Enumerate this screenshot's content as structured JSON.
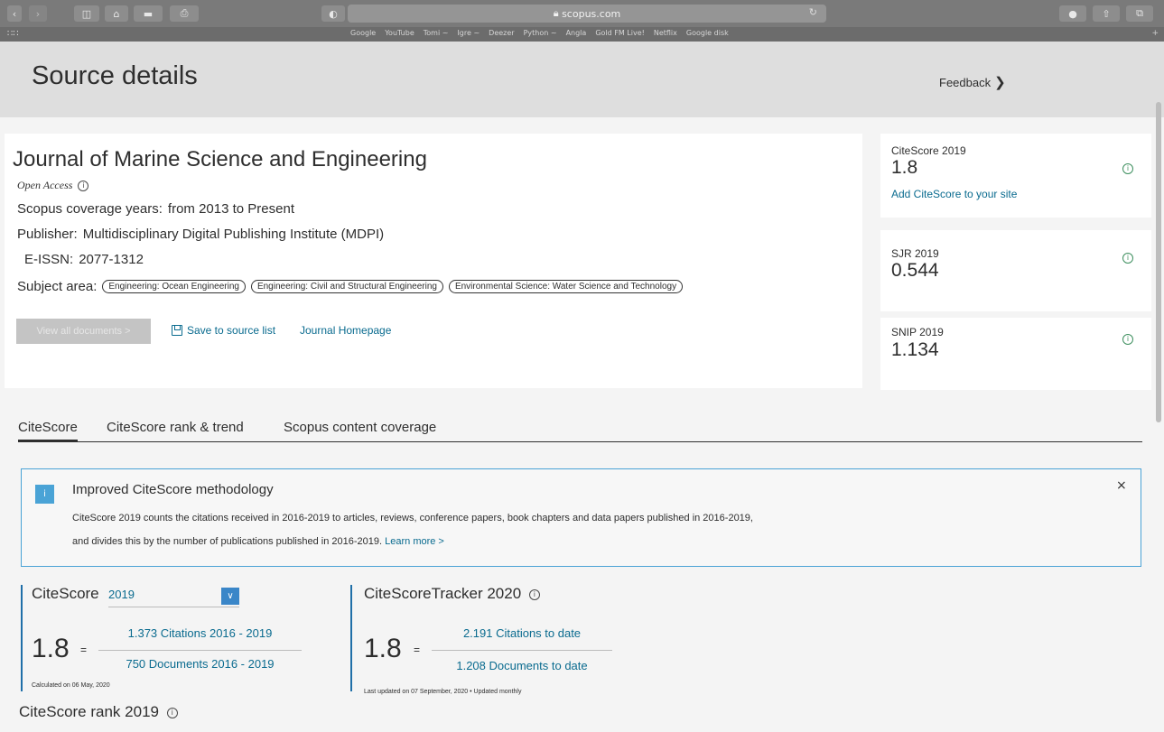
{
  "browser": {
    "url": "scopus.com",
    "bookmarks": [
      "Google",
      "YouTube",
      "Tomi ~",
      "Igre ~",
      "Deezer",
      "Python ~",
      "Angla",
      "Gold FM Live!",
      "Netflix",
      "Google disk"
    ]
  },
  "header": {
    "title": "Source details",
    "feedback_label": "Feedback"
  },
  "journal": {
    "title": "Journal of Marine Science and Engineering",
    "access": "Open Access",
    "coverage_label": "Scopus coverage years:",
    "coverage_value": "from 2013 to Present",
    "publisher_label": "Publisher:",
    "publisher_value": "Multidisciplinary Digital Publishing Institute (MDPI)",
    "eissn_label": "E-ISSN:",
    "eissn_value": "2077-1312",
    "subject_label": "Subject area:",
    "subjects": [
      "Engineering: Ocean Engineering",
      "Engineering: Civil and Structural Engineering",
      "Environmental Science: Water Science and Technology"
    ],
    "view_docs_label": "View all documents >",
    "save_label": "Save to source list",
    "homepage_label": "Journal Homepage"
  },
  "metrics": {
    "citescore": {
      "label": "CiteScore 2019",
      "value": "1.8",
      "link": "Add CiteScore to your site"
    },
    "sjr": {
      "label": "SJR 2019",
      "value": "0.544"
    },
    "snip": {
      "label": "SNIP 2019",
      "value": "1.134"
    }
  },
  "tabs": [
    "CiteScore",
    "CiteScore rank & trend",
    "Scopus content coverage"
  ],
  "notice": {
    "title": "Improved CiteScore methodology",
    "text": "CiteScore 2019 counts the citations received in 2016-2019 to articles, reviews, conference papers, book chapters and data papers published in 2016-2019, and divides this by the number of publications published in 2016-2019.",
    "learn_more": "Learn more >",
    "close": "×"
  },
  "citescore_calc": {
    "heading": "CiteScore",
    "year": "2019",
    "value": "1.8",
    "numerator": "1.373 Citations 2016 - 2019",
    "denominator": "750 Documents 2016 - 2019",
    "note": "Calculated on 06 May, 2020"
  },
  "tracker": {
    "heading": "CiteScoreTracker 2020",
    "value": "1.8",
    "numerator": "2.191 Citations to date",
    "denominator": "1.208 Documents to date",
    "note": "Last updated on 07 September, 2020 • Updated monthly"
  },
  "rank_heading": "CiteScore rank 2019",
  "colors": {
    "link": "#0a6b8f",
    "accent_blue": "#4aa3d6",
    "info_green": "#3d8f5e"
  }
}
